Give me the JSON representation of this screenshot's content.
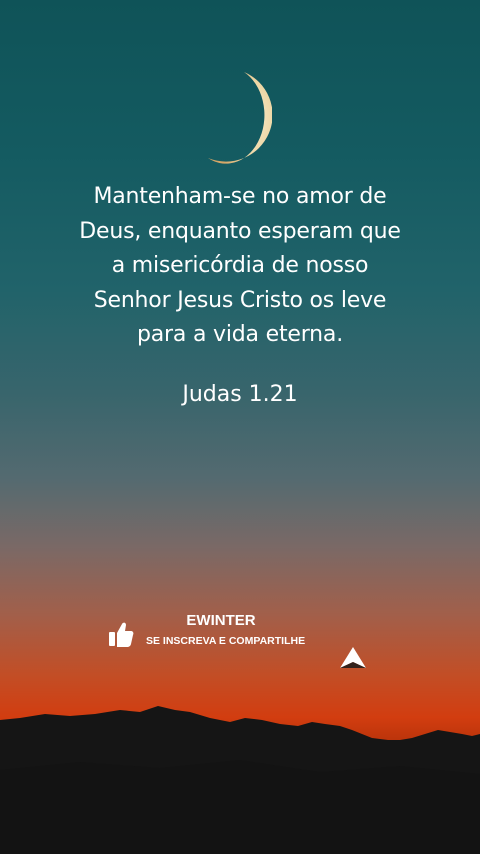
{
  "verse": {
    "lines": [
      "Mantenham-se no amor de",
      "Deus, enquanto esperam que",
      "a misericórdia de nosso",
      "Senhor Jesus Cristo os leve",
      "para a vida eterna."
    ],
    "reference": "Judas 1.21"
  },
  "branding": {
    "name": "EWINTER",
    "tagline": "SE INSCREVA E COMPARTILHE",
    "icons": [
      "thumbs-up-icon",
      "arrow-logo-icon"
    ]
  },
  "scene": {
    "elements": [
      "crescent-moon",
      "mountain-silhouette"
    ],
    "colors": {
      "sky_top": "#0f5358",
      "sky_mid": "#546a70",
      "sunset": "#d23d10",
      "moon": "#f4e3bf",
      "text": "#ffffff",
      "mountains": "#151515"
    }
  }
}
